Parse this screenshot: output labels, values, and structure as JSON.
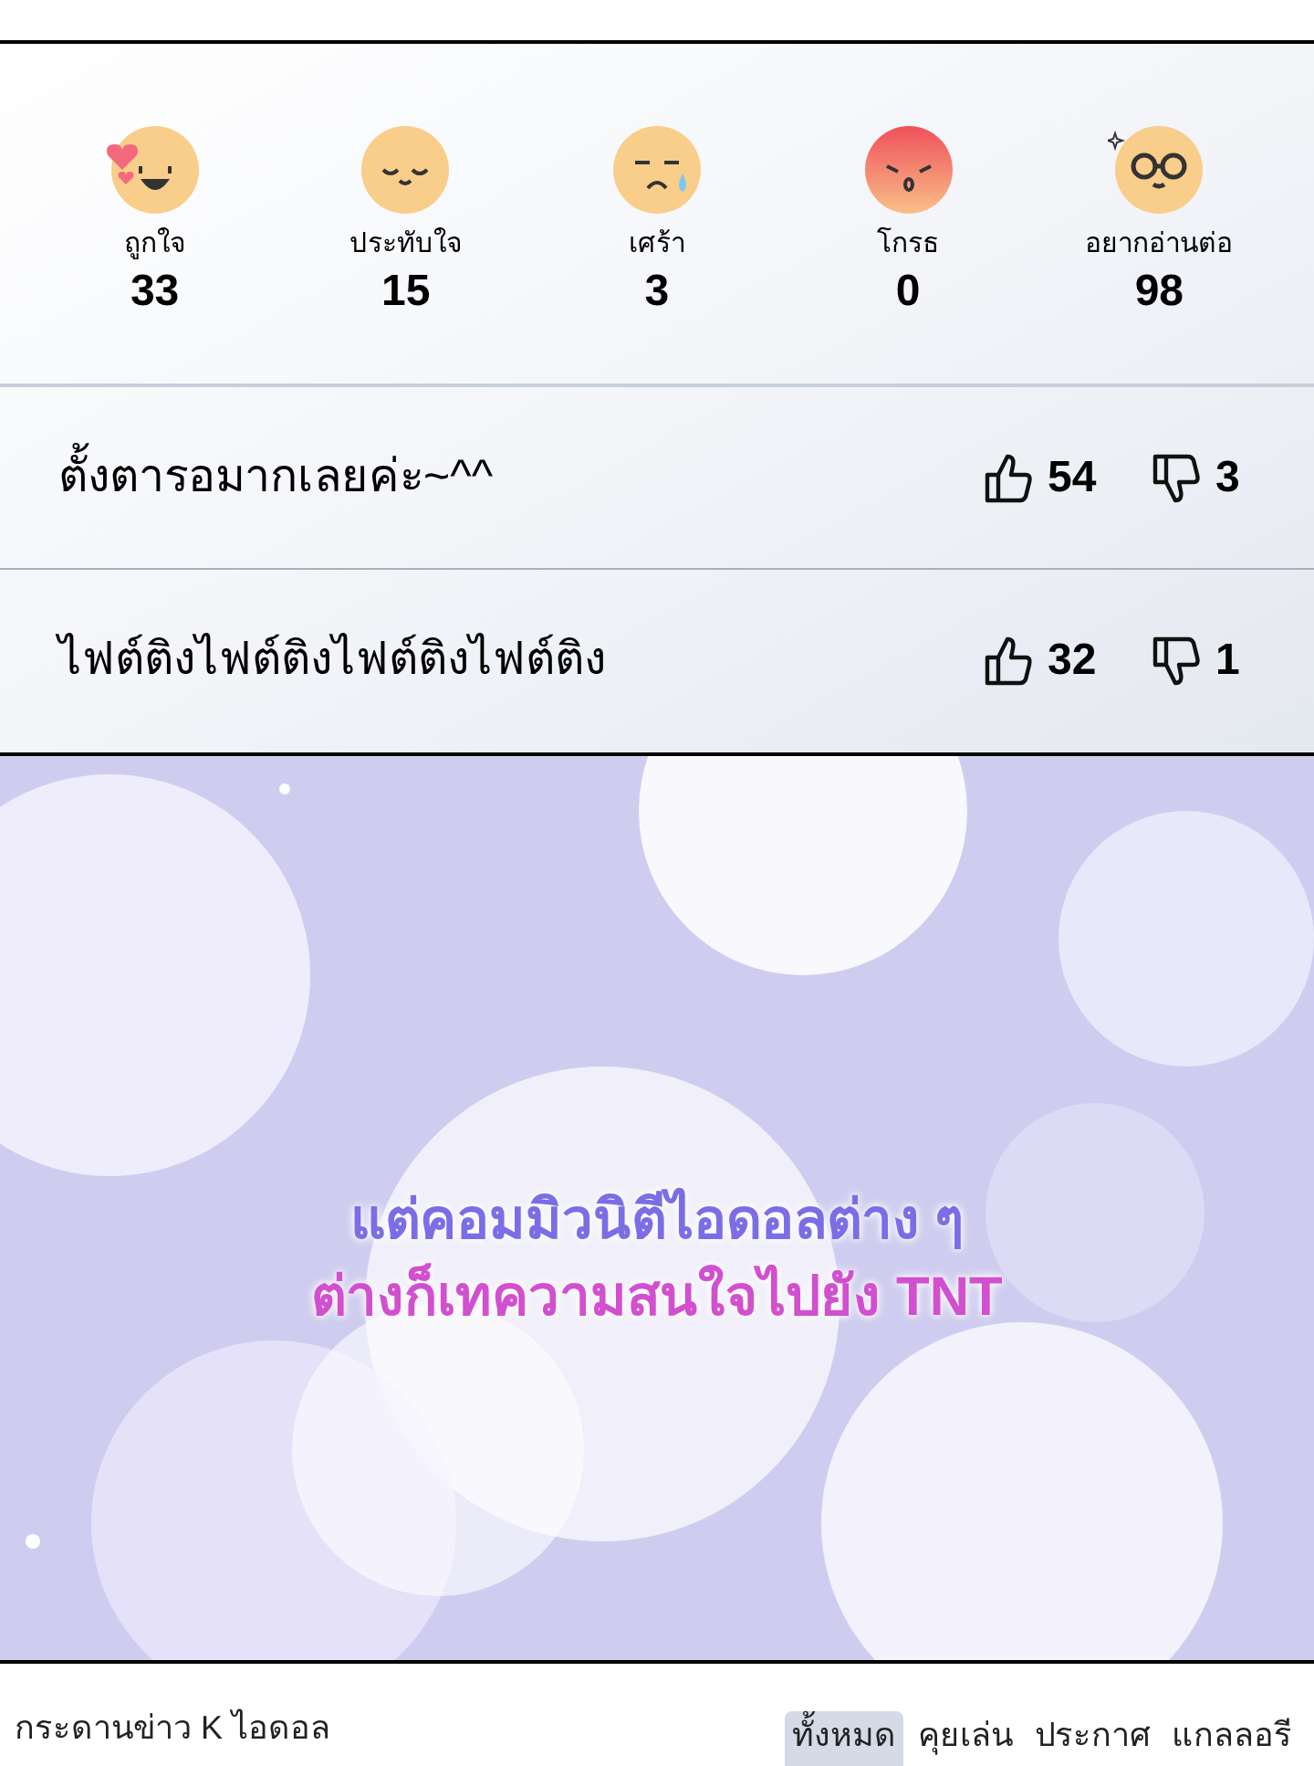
{
  "reactions": [
    {
      "kind": "love",
      "label": "ถูกใจ",
      "count": "33"
    },
    {
      "kind": "touched",
      "label": "ประทับใจ",
      "count": "15"
    },
    {
      "kind": "sad",
      "label": "เศร้า",
      "count": "3"
    },
    {
      "kind": "angry",
      "label": "โกรธ",
      "count": "0"
    },
    {
      "kind": "curious",
      "label": "อยากอ่านต่อ",
      "count": "98"
    }
  ],
  "comments": [
    {
      "text": "ตั้งตารอมากเลยค่ะ~^^",
      "likes": "54",
      "dislikes": "3"
    },
    {
      "text": "ไฟต์ติงไฟต์ติงไฟต์ติงไฟต์ติง",
      "likes": "32",
      "dislikes": "1"
    }
  ],
  "caption": {
    "lines": [
      {
        "text": "แต่คอมมิวนิตีไอดอลต่าง ๆ",
        "color": "#7a6ee6"
      },
      {
        "text": "ต่างก็เทความสนใจไปยัง TNT",
        "color": "#d24fcf"
      }
    ]
  },
  "board": {
    "title": "กระดานข่าว K ไอดอล",
    "tabs": [
      {
        "label": "ทั้งหมด",
        "selected": true
      },
      {
        "label": "คุยเล่น",
        "selected": false
      },
      {
        "label": "ประกาศ",
        "selected": false
      },
      {
        "label": "แกลลอรี",
        "selected": false
      }
    ]
  }
}
